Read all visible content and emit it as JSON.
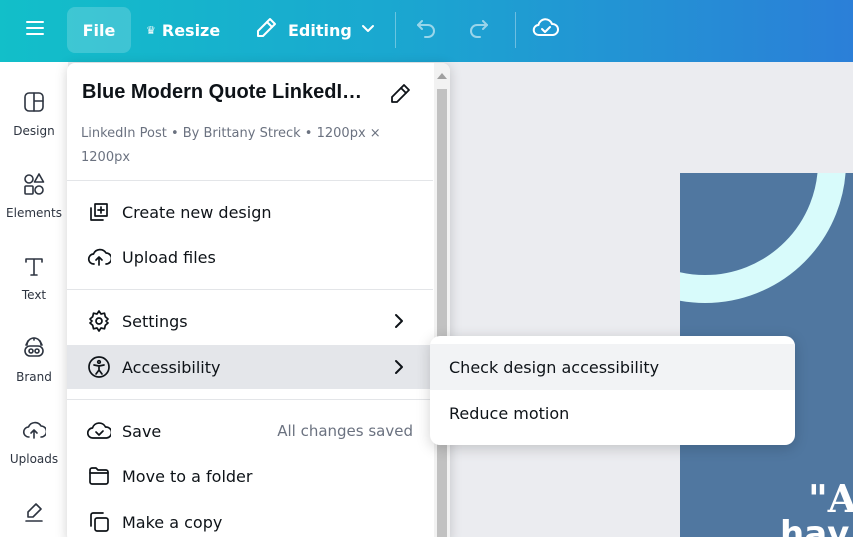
{
  "toolbar": {
    "file_label": "File",
    "resize_label": "Resize",
    "editing_label": "Editing",
    "icons": [
      "hamburger-menu-icon",
      "crown-icon",
      "pencil-icon",
      "chevron-down-icon",
      "undo-icon",
      "redo-icon",
      "cloud-check-icon"
    ]
  },
  "sidebar": {
    "items": [
      {
        "label": "Design",
        "icon": "layout-icon"
      },
      {
        "label": "Elements",
        "icon": "shapes-icon"
      },
      {
        "label": "Text",
        "icon": "text-icon"
      },
      {
        "label": "Brand",
        "icon": "brand-icon"
      },
      {
        "label": "Uploads",
        "icon": "cloud-upload-icon"
      },
      {
        "label": "",
        "icon": "draw-icon"
      }
    ]
  },
  "file_menu": {
    "title": "Blue Modern Quote LinkedI…",
    "meta": "LinkedIn Post • By Brittany Streck • 1200px × 1200px",
    "items": [
      {
        "label": "Create new design",
        "icon": "add-design-icon"
      },
      {
        "label": "Upload files",
        "icon": "upload-cloud-icon"
      },
      {
        "label": "Settings",
        "icon": "gear-icon"
      },
      {
        "label": "Accessibility",
        "icon": "accessibility-icon"
      },
      {
        "label": "Save",
        "icon": "cloud-check-icon",
        "status": "All changes saved"
      },
      {
        "label": "Move to a folder",
        "icon": "folder-icon"
      },
      {
        "label": "Make a copy",
        "icon": "copy-icon"
      }
    ]
  },
  "submenu": {
    "items": [
      {
        "label": "Check design accessibility"
      },
      {
        "label": "Reduce motion"
      }
    ]
  },
  "canvas": {
    "quote_line1": "\"A",
    "quote_line2": "hav",
    "background_color": "#5077a0",
    "ring_color": "#d8fbfb"
  }
}
